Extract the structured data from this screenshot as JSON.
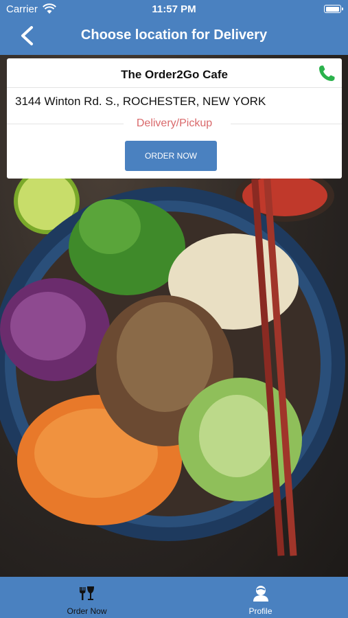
{
  "status_bar": {
    "carrier": "Carrier",
    "time": "11:57 PM"
  },
  "nav": {
    "title": "Choose location for Delivery",
    "back_icon": "chevron-left-icon"
  },
  "location": {
    "name": "The Order2Go Cafe",
    "address": "3144 Winton Rd. S., ROCHESTER, NEW YORK",
    "service_mode": "Delivery/Pickup",
    "order_button": "ORDER NOW",
    "phone_icon": "phone-icon",
    "phone_color": "#2bb24c"
  },
  "tab_bar": {
    "items": [
      {
        "label": "Order Now",
        "icon": "dining-icon",
        "selected": true
      },
      {
        "label": "Profile",
        "icon": "user-icon",
        "selected": false
      }
    ]
  },
  "colors": {
    "primary": "#4a81c0",
    "accent_text": "#d9696b",
    "card_bg": "#ffffff"
  }
}
